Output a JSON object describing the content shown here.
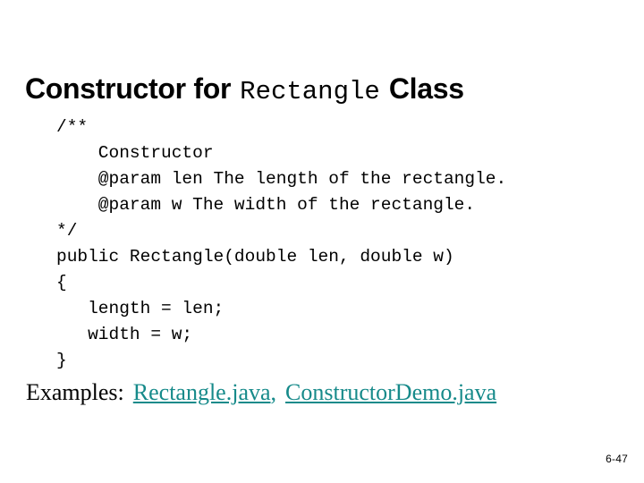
{
  "slide": {
    "background_color": "#ffffff",
    "title": {
      "prefix": "Constructor for",
      "code_word": "Rectangle",
      "suffix": "Class"
    },
    "code": {
      "language": "java",
      "lines": [
        "/**",
        "    Constructor",
        "    @param len The length of the rectangle.",
        "    @param w The width of the rectangle.",
        "*/",
        "public Rectangle(double len, double w)",
        "{",
        "   length = len;",
        "   width = w;",
        "}"
      ]
    },
    "examples": {
      "label": "Examples:",
      "separator": ",",
      "link_color": "#168a8a",
      "links": [
        "Rectangle.java",
        "ConstructorDemo.java"
      ]
    },
    "page_number": "6-47"
  }
}
